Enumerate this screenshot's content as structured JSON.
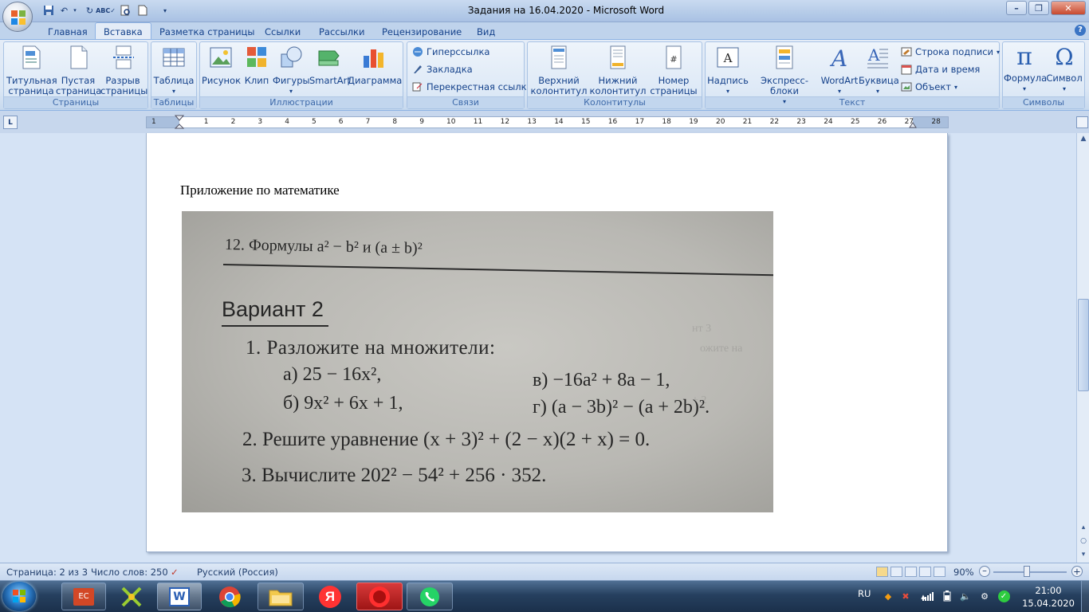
{
  "window": {
    "title": "Задания на 16.04.2020 - Microsoft Word"
  },
  "tabs": [
    {
      "label": "Главная"
    },
    {
      "label": "Вставка"
    },
    {
      "label": "Разметка страницы"
    },
    {
      "label": "Ссылки"
    },
    {
      "label": "Рассылки"
    },
    {
      "label": "Рецензирование"
    },
    {
      "label": "Вид"
    }
  ],
  "ribbon": {
    "pages_group": {
      "label": "Страницы",
      "cover": "Титульная страница",
      "blank": "Пустая страница",
      "break": "Разрыв страницы"
    },
    "tables_group": {
      "label": "Таблицы",
      "table": "Таблица"
    },
    "illustrations_group": {
      "label": "Иллюстрации",
      "picture": "Рисунок",
      "clip": "Клип",
      "shapes": "Фигуры",
      "smartart": "SmartArt",
      "chart": "Диаграмма"
    },
    "links_group": {
      "label": "Связи",
      "hyperlink": "Гиперссылка",
      "bookmark": "Закладка",
      "crossref": "Перекрестная ссылка"
    },
    "headers_group": {
      "label": "Колонтитулы",
      "header": "Верхний колонтитул",
      "footer": "Нижний колонтитул",
      "pagenum": "Номер страницы"
    },
    "text_group": {
      "label": "Текст",
      "textbox": "Надпись",
      "quickparts": "Экспресс-блоки",
      "wordart": "WordArt",
      "dropcap": "Буквица",
      "signature": "Строка подписи",
      "datetime": "Дата и время",
      "object": "Объект"
    },
    "symbols_group": {
      "label": "Символы",
      "equation": "Формула",
      "symbol": "Символ"
    }
  },
  "ruler": {
    "ticks": [
      "1",
      "1",
      "2",
      "3",
      "4",
      "5",
      "6",
      "7",
      "8",
      "9",
      "10",
      "11",
      "12",
      "13",
      "14",
      "15",
      "16",
      "17",
      "18",
      "19",
      "20",
      "21",
      "22",
      "23",
      "24",
      "25",
      "26",
      "27",
      "28"
    ]
  },
  "document": {
    "heading": "Приложение по математике",
    "photo": {
      "section_title": "12. Формулы a² − b² и (a ± b)²",
      "variant": "Вариант 2",
      "task1": "1. Разложите на множители:",
      "a": "а) 25 − 16x²,",
      "v": "в) −16a² + 8a − 1,",
      "b": "б) 9x² + 6x + 1,",
      "g": "г) (a − 3b)² − (a + 2b)².",
      "task2": "2. Решите уравнение (x + 3)² + (2 − x)(2 + x) = 0.",
      "task3": "3. Вычислите 202² − 54² + 256 · 352."
    }
  },
  "status": {
    "page": "Страница: 2 из 3",
    "words": "Число слов: 250",
    "language": "Русский (Россия)",
    "zoom": "90%"
  },
  "taskbar": {
    "lang": "RU",
    "time": "21:00",
    "date": "15.04.2020"
  }
}
